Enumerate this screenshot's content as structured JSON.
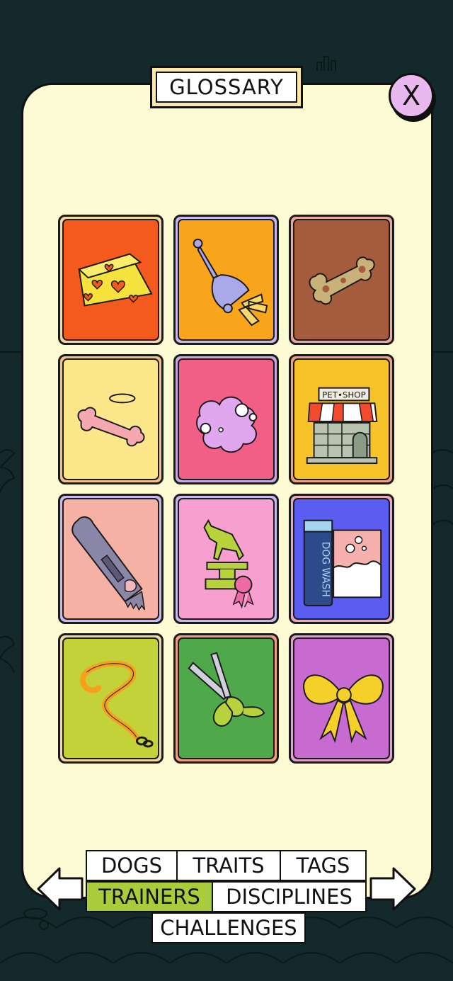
{
  "header": {
    "title": "GLOSSARY"
  },
  "close_button": {
    "label": "X"
  },
  "cards": [
    {
      "name": "cheese",
      "color": "#f45a1e"
    },
    {
      "name": "bell",
      "color": "#f9a51c"
    },
    {
      "name": "bone",
      "color": "#a45c3c"
    },
    {
      "name": "angel-bone",
      "color": "#fce68a"
    },
    {
      "name": "bubble-cloud",
      "color": "#f15f86"
    },
    {
      "name": "pet-shop",
      "color": "#f6c42a",
      "sign": "PET•SHOP"
    },
    {
      "name": "clippers",
      "color": "#f6b1a5"
    },
    {
      "name": "trophy",
      "color": "#f7a0cf"
    },
    {
      "name": "dog-wash",
      "color": "#5b5cf0",
      "sign": "DOG WASH"
    },
    {
      "name": "leash",
      "color": "#c4d23a"
    },
    {
      "name": "scissors",
      "color": "#4fa84a"
    },
    {
      "name": "bow",
      "color": "#c76bd0"
    }
  ],
  "tabs": {
    "dogs": "DOGS",
    "traits": "TRAITS",
    "tags": "TAGS",
    "trainers": "TRAINERS",
    "disciplines": "DISCIPLINES",
    "challenges": "CHALLENGES",
    "active": "trainers"
  },
  "colors": {
    "panel": "#fdfbd4",
    "background": "#13292b",
    "active_tab": "#a9cc3c",
    "close": "#e9b8ef"
  }
}
